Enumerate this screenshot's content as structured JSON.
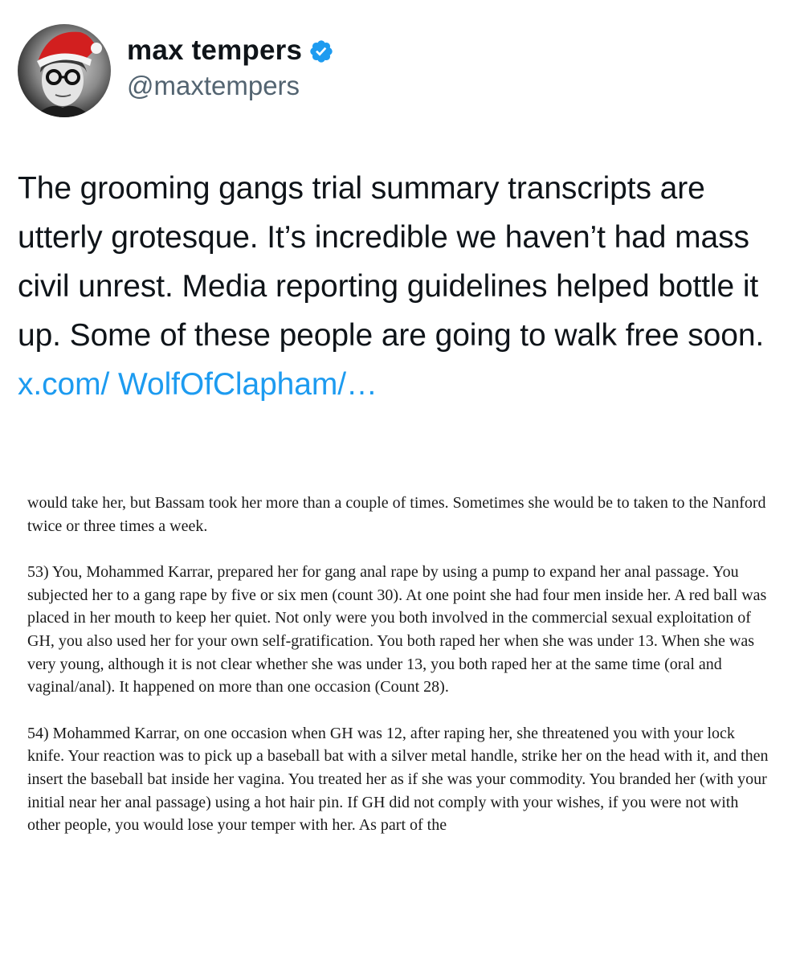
{
  "tweet": {
    "author": {
      "display_name": "max tempers",
      "handle": "@maxtempers",
      "verified_icon": "verified-badge-icon",
      "badge_color": "#1d9bf0"
    },
    "text": "The grooming gangs trial summary transcripts are utterly grotesque. It’s incredible we haven’t had mass civil unrest. Media reporting guidelines helped bottle it up. Some of these people are going to walk free soon. ",
    "link_text": "x.com/ WolfOfClapham/…",
    "link_color": "#1d9bf0"
  },
  "document": {
    "paragraphs": [
      "would take her, but Bassam took her more than a couple of times. Sometimes she would be to taken to the Nanford twice or three times a week.",
      "53) You, Mohammed Karrar, prepared her for gang anal rape by using a pump to expand her anal passage. You subjected her to a gang rape by five or six men (count 30). At one point she had four men inside her. A red ball was placed in her mouth to keep her quiet. Not only were you both involved in the commercial sexual exploitation of GH, you also used her for your own self-gratification. You both raped her when she was under 13. When she was very young, although it is not clear whether she was under 13, you both raped her at the same time (oral and vaginal/anal). It happened on more than one occasion (Count 28).",
      "54) Mohammed Karrar, on one occasion when GH was 12, after raping her, she threatened you with your lock knife. Your reaction was to pick up a baseball bat with a silver metal handle, strike her on the head with it, and then insert the baseball bat inside her vagina. You treated her as if she was your commodity. You branded her (with your initial near her anal passage) using a hot hair pin. If GH did not comply with your wishes, if you were not with other people, you would lose your temper with her. As part of the"
    ]
  }
}
